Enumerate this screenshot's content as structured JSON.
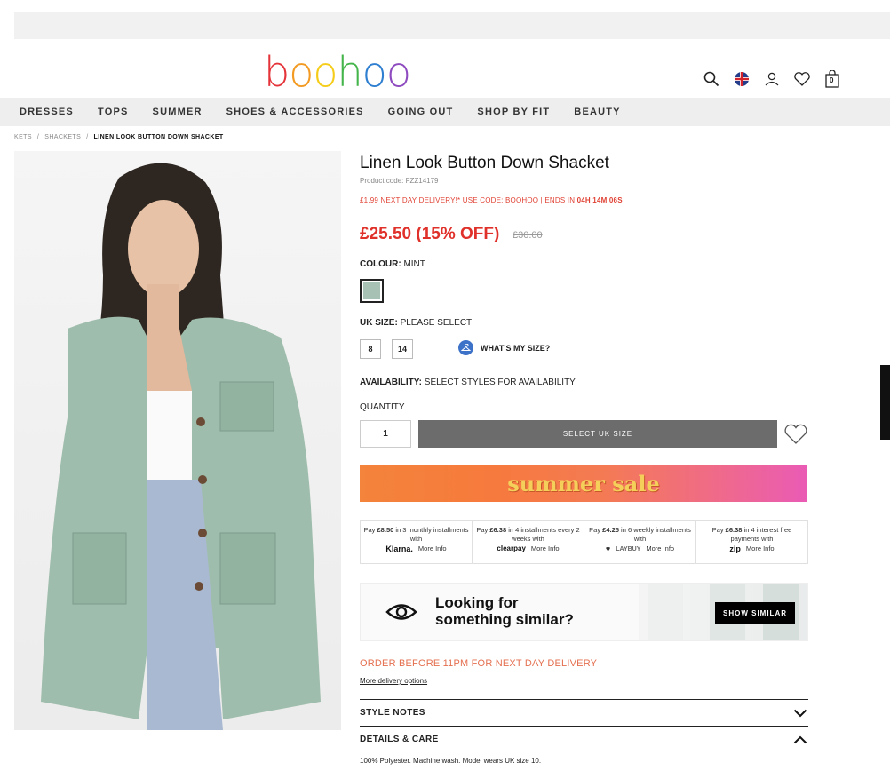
{
  "brand": {
    "logo_letters": [
      "b",
      "o",
      "o",
      "h",
      "o",
      "o"
    ],
    "logo_colors": [
      "#e4343a",
      "#f39a22",
      "#f5cc17",
      "#43b54a",
      "#2f7fd1",
      "#8e4bbf"
    ]
  },
  "header": {
    "icons": [
      "search-icon",
      "uk-flag-icon",
      "account-icon",
      "wishlist-icon",
      "bag-icon"
    ],
    "bag_count": "0"
  },
  "nav": {
    "items": [
      "Dresses",
      "Tops",
      "Summer",
      "Shoes & Accessories",
      "Going Out",
      "Shop By Fit",
      "Beauty"
    ]
  },
  "breadcrumb": {
    "items": [
      "KETS",
      "/",
      "SHACKETS",
      "/"
    ],
    "current": "LINEN LOOK BUTTON DOWN SHACKET"
  },
  "product": {
    "title": "Linen Look Button Down Shacket",
    "code": "Product code: FZZ14179",
    "promo_text": "£1.99 NEXT DAY DELIVERY!* USE CODE: BOOHOO | ENDS IN ",
    "promo_time": "04H 14M 06S",
    "price": "£25.50 (15% OFF)",
    "was_price": "£30.00",
    "colour_label": "COLOUR:",
    "colour_value": "MINT",
    "swatch_color": "#a7c2b4",
    "size_label": "UK SIZE:",
    "size_value": "PLEASE SELECT",
    "sizes": [
      "8",
      "14"
    ],
    "whats_my_size": "WHAT'S MY SIZE?",
    "availability_label": "AVAILABILITY:",
    "availability_value": "SELECT STYLES FOR AVAILABILITY",
    "quantity_label": "QUANTITY",
    "quantity": "1",
    "add_button": "Select UK Size"
  },
  "banner": {
    "text": "summer sale"
  },
  "payments": [
    {
      "pre": "Pay ",
      "amount": "£8.50",
      "post": " in 3 monthly installments with",
      "brand": "Klarna.",
      "more": "More Info"
    },
    {
      "pre": "Pay ",
      "amount": "£6.38",
      "post": " in 4 installments every 2 weeks with",
      "brand": "clearpay",
      "more": "More Info"
    },
    {
      "pre": "Pay ",
      "amount": "£4.25",
      "post": " in 6 weekly installments with",
      "brand": "LAYBUY",
      "more": "More Info"
    },
    {
      "pre": "Pay ",
      "amount": "£6.38",
      "post": " in 4 interest free payments with",
      "brand": "zip",
      "more": "More Info"
    }
  ],
  "similar": {
    "line1": "Looking for",
    "line2": "something similar?",
    "button": "Show Similar"
  },
  "delivery": {
    "order_text": "Order before 11pm for next day delivery",
    "more_link": "More delivery options"
  },
  "accordions": {
    "style_notes": "Style Notes",
    "details_care": "Details & Care",
    "care_text": "100% Polyester. Machine wash. Model wears UK size 10."
  },
  "colors": {
    "sale_red": "#e0302a",
    "button_grey": "#6c6c6c",
    "nav_bg": "#eeeeee"
  }
}
